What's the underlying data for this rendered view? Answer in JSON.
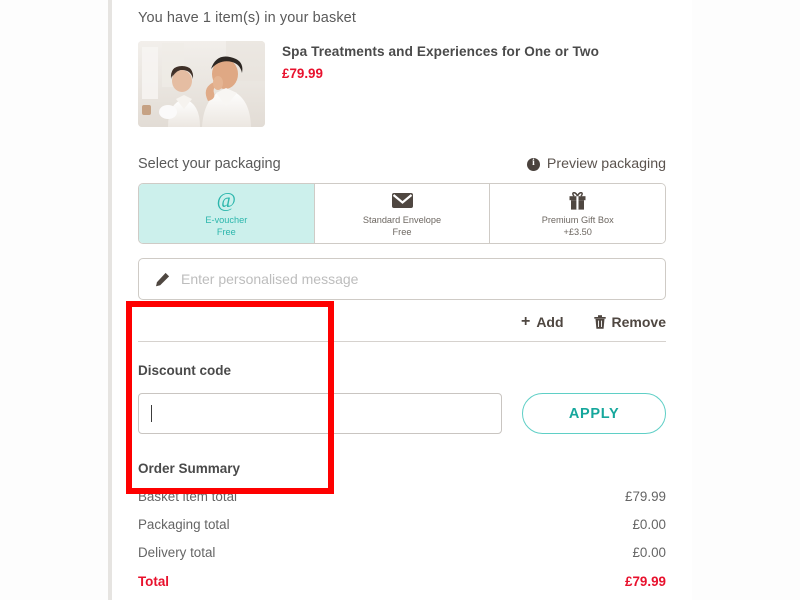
{
  "basket": {
    "count_text": "You have 1 item(s) in your basket",
    "item": {
      "title": "Spa Treatments and Experiences for One or Two",
      "price": "£79.99",
      "image_alt": "spa-couple-in-robes"
    }
  },
  "packaging": {
    "label": "Select your packaging",
    "preview_label": "Preview packaging",
    "preview_icon": "info-icon",
    "options": [
      {
        "icon": "at-icon",
        "name": "E-voucher",
        "price": "Free",
        "selected": true
      },
      {
        "icon": "envelope-icon",
        "name": "Standard Envelope",
        "price": "Free",
        "selected": false
      },
      {
        "icon": "gift-box-icon",
        "name": "Premium Gift Box",
        "price": "+£3.50",
        "selected": false
      }
    ]
  },
  "message": {
    "icon": "pencil-icon",
    "placeholder": "Enter personalised message",
    "value": ""
  },
  "actions": {
    "add_label": "Add",
    "add_icon": "plus-icon",
    "remove_label": "Remove",
    "remove_icon": "trash-icon"
  },
  "discount": {
    "label": "Discount code",
    "input_value": "",
    "apply_label": "APPLY"
  },
  "order_summary": {
    "title": "Order Summary",
    "rows": [
      {
        "label": "Basket item total",
        "value": "£79.99"
      },
      {
        "label": "Packaging total",
        "value": "£0.00"
      },
      {
        "label": "Delivery total",
        "value": "£0.00"
      }
    ],
    "total": {
      "label": "Total",
      "value": "£79.99"
    }
  },
  "colors": {
    "accent_teal": "#2bb6ac",
    "price_red": "#e8112d",
    "annotation_red": "#fe0000",
    "selected_bg": "#ccf0ec"
  }
}
